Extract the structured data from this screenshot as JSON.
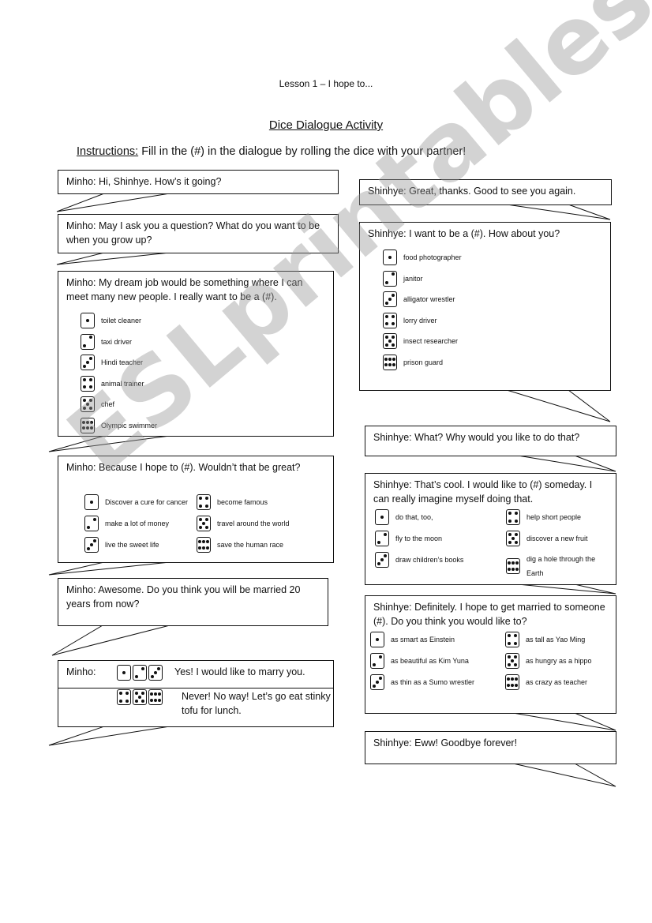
{
  "header": {
    "lesson": "Lesson 1 – I hope to...",
    "title": "Dice Dialogue Activity",
    "instructions_label": "Instructions:",
    "instructions_text": " Fill in the (#) in the dialogue by rolling the dice with your partner!"
  },
  "minho": {
    "b1": "Minho: Hi, Shinhye.  How’s it going?",
    "b2": "Minho: May I ask you a question?  What do you want to be when you grow up?",
    "b3": "Minho: My dream job would be something where I can meet many new people.  I really want to be a (#).",
    "b3_options": [
      "toilet cleaner",
      "taxi driver",
      "Hindi teacher",
      "animal trainer",
      "chef",
      "Olympic swimmer"
    ],
    "b4": "Minho: Because I hope to (#).  Wouldn’t that be great?",
    "b4_options": [
      "Discover a cure for cancer",
      "make a lot of money",
      "live the sweet life",
      "become famous",
      "travel around the world",
      "save the human race"
    ],
    "b5": "Minho: Awesome.  Do you think you will be married 20 years from now?",
    "b6_speaker": "Minho:",
    "b6_yes": "Yes!  I would like to marry you.",
    "b6_no": "Never!  No way!  Let’s go eat stinky tofu for lunch."
  },
  "shinhye": {
    "b1": "Shinhye: Great, thanks.   Good to see you again.",
    "b2": "Shinhye: I want to be a (#).  How about you?",
    "b2_options": [
      "food photographer",
      "janitor",
      "alligator wrestler",
      "lorry driver",
      "insect researcher",
      "prison guard"
    ],
    "b3": "Shinhye: What? Why would you like to do that?",
    "b4": "Shinhye: That’s cool.  I would like to (#) someday.  I can really imagine myself doing that.",
    "b4_options": [
      "do that, too,",
      "fly to the moon",
      "draw children’s books",
      "help short people",
      "discover a new fruit",
      "dig a hole through the Earth"
    ],
    "b5": "Shinhye: Definitely.  I hope to get married to someone (#).   Do you think you would like to?",
    "b5_options": [
      "as smart as Einstein",
      "as beautiful as Kim Yuna",
      "as thin as a Sumo wrestler",
      "as tall as Yao Ming",
      "as hungry as a hippo",
      "as crazy as teacher"
    ],
    "b6": "Shinhye: Eww!  Goodbye forever!"
  },
  "watermark": "ESLprintables.com"
}
